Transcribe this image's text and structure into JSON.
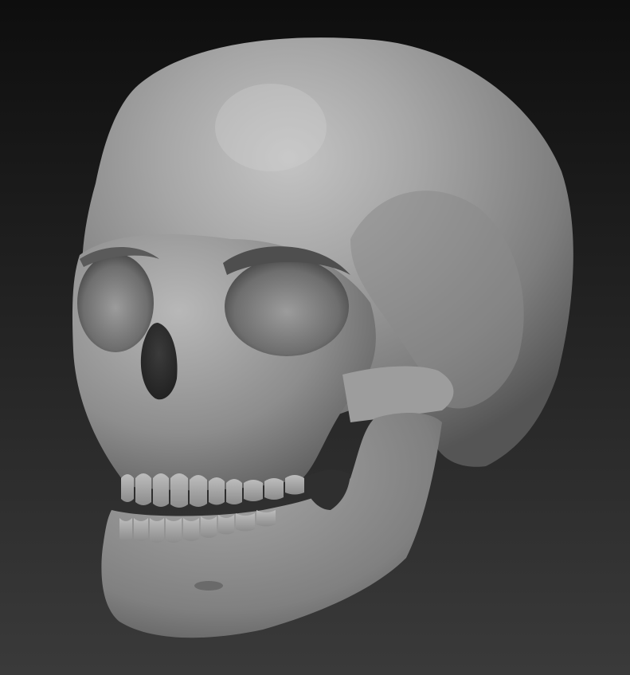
{
  "viewport": {
    "background_top": "#0e0e0e",
    "background_bottom": "#3a3a3a"
  },
  "model": {
    "material_light": "#b3b3b3",
    "material_mid": "#8a8a8a",
    "material_dark": "#4a4a4a",
    "material_shadow": "#2a2a2a"
  }
}
